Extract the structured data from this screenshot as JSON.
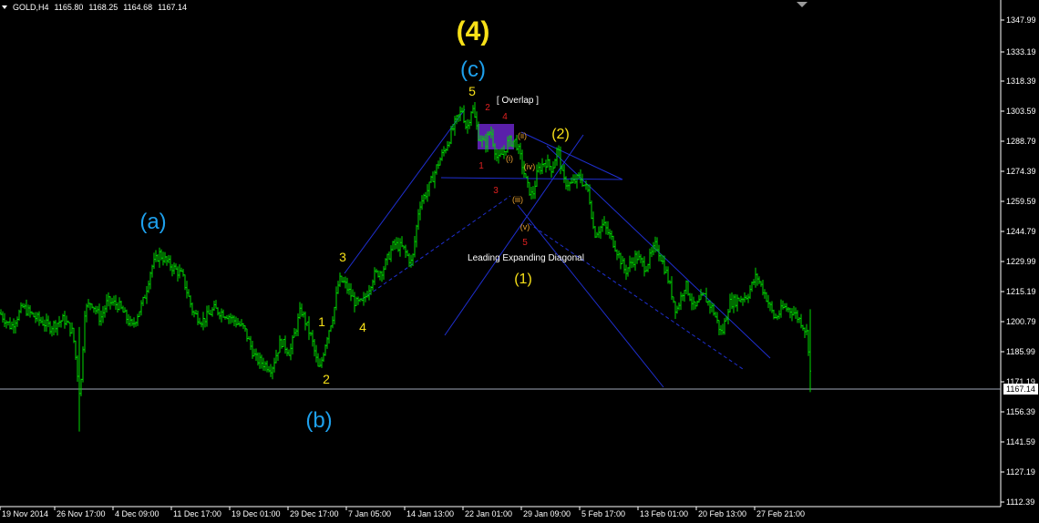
{
  "header": {
    "symbol": "GOLD,H4",
    "open": "1165.80",
    "high": "1168.25",
    "low": "1164.68",
    "close": "1167.14"
  },
  "colors": {
    "background": "#000000",
    "candles": "#00d800",
    "trendline": "#1f2fd0",
    "wave_yellow": "#f7e018",
    "wave_blue": "#1ea0ec",
    "wave_red": "#e02020",
    "wave_orange": "#e8a030",
    "overlap_box": "#6a24c8",
    "current_price_line": "#a0a8b8"
  },
  "chart_data": {
    "type": "candlestick",
    "symbol": "GOLD",
    "timeframe": "H4",
    "ylim": [
      1105.0,
      1357.0
    ],
    "y_ticks": [
      "1347.99",
      "1333.19",
      "1318.39",
      "1303.59",
      "1288.79",
      "1274.39",
      "1259.59",
      "1244.79",
      "1229.99",
      "1215.19",
      "1200.79",
      "1185.99",
      "1171.19",
      "1156.39",
      "1141.59",
      "1127.19",
      "1112.39"
    ],
    "x_ticks": [
      "19 Nov 2014",
      "26 Nov 17:00",
      "4 Dec 09:00",
      "11 Dec 17:00",
      "19 Dec 01:00",
      "29 Dec 17:00",
      "7 Jan 05:00",
      "14 Jan 13:00",
      "22 Jan 01:00",
      "29 Jan 09:00",
      "5 Feb 17:00",
      "13 Feb 01:00",
      "20 Feb 13:00",
      "27 Feb 21:00"
    ],
    "current_price": "1167.14",
    "price_path": [
      [
        0,
        1203
      ],
      [
        12,
        1196
      ],
      [
        25,
        1206
      ],
      [
        38,
        1201
      ],
      [
        55,
        1196
      ],
      [
        70,
        1200
      ],
      [
        80,
        1193
      ],
      [
        88,
        1160
      ],
      [
        93,
        1204
      ],
      [
        100,
        1209
      ],
      [
        110,
        1200
      ],
      [
        118,
        1209
      ],
      [
        130,
        1207
      ],
      [
        145,
        1196
      ],
      [
        158,
        1210
      ],
      [
        166,
        1226
      ],
      [
        175,
        1233
      ],
      [
        185,
        1228
      ],
      [
        200,
        1222
      ],
      [
        212,
        1203
      ],
      [
        222,
        1199
      ],
      [
        235,
        1205
      ],
      [
        250,
        1202
      ],
      [
        268,
        1195
      ],
      [
        280,
        1180
      ],
      [
        298,
        1175
      ],
      [
        308,
        1189
      ],
      [
        318,
        1183
      ],
      [
        330,
        1205
      ],
      [
        342,
        1190
      ],
      [
        350,
        1173
      ],
      [
        358,
        1190
      ],
      [
        366,
        1203
      ],
      [
        372,
        1220
      ],
      [
        378,
        1218
      ],
      [
        390,
        1208
      ],
      [
        398,
        1208
      ],
      [
        410,
        1222
      ],
      [
        420,
        1225
      ],
      [
        432,
        1238
      ],
      [
        442,
        1236
      ],
      [
        452,
        1228
      ],
      [
        460,
        1258
      ],
      [
        470,
        1266
      ],
      [
        480,
        1278
      ],
      [
        490,
        1288
      ],
      [
        500,
        1300
      ],
      [
        507,
        1306
      ],
      [
        512,
        1296
      ],
      [
        518,
        1308
      ],
      [
        525,
        1293
      ],
      [
        532,
        1288
      ],
      [
        538,
        1296
      ],
      [
        546,
        1280
      ],
      [
        552,
        1284
      ],
      [
        558,
        1290
      ],
      [
        566,
        1290
      ],
      [
        572,
        1280
      ],
      [
        578,
        1268
      ],
      [
        584,
        1262
      ],
      [
        590,
        1275
      ],
      [
        598,
        1280
      ],
      [
        606,
        1276
      ],
      [
        612,
        1287
      ],
      [
        618,
        1270
      ],
      [
        626,
        1268
      ],
      [
        636,
        1272
      ],
      [
        646,
        1264
      ],
      [
        652,
        1243
      ],
      [
        662,
        1248
      ],
      [
        674,
        1238
      ],
      [
        686,
        1224
      ],
      [
        698,
        1232
      ],
      [
        708,
        1226
      ],
      [
        720,
        1238
      ],
      [
        732,
        1222
      ],
      [
        742,
        1204
      ],
      [
        752,
        1218
      ],
      [
        762,
        1205
      ],
      [
        772,
        1212
      ],
      [
        782,
        1205
      ],
      [
        792,
        1192
      ],
      [
        800,
        1208
      ],
      [
        810,
        1210
      ],
      [
        820,
        1212
      ],
      [
        830,
        1222
      ],
      [
        840,
        1212
      ],
      [
        850,
        1200
      ],
      [
        860,
        1206
      ],
      [
        870,
        1204
      ],
      [
        880,
        1198
      ],
      [
        886,
        1192
      ],
      [
        890,
        1167
      ]
    ]
  },
  "annotations": {
    "wave_4": "(4)",
    "wave_c": "(c)",
    "wave_a": "(a)",
    "wave_b": "(b)",
    "wave_1_circle": "(1)",
    "wave_2_circle": "(2)",
    "overlap": "[ Overlap ]",
    "leading_diagonal": "Leading Expanding Diagonal",
    "yellow_1": "1",
    "yellow_2": "2",
    "yellow_3": "3",
    "yellow_4": "4",
    "yellow_5": "5",
    "red_1": "1",
    "red_2": "2",
    "red_3": "3",
    "red_4": "4",
    "red_5": "5",
    "sub_i": "(i)",
    "sub_ii": "(ii)",
    "sub_iii": "(iii)",
    "sub_iv": "(iv)",
    "sub_v": "(v)"
  }
}
